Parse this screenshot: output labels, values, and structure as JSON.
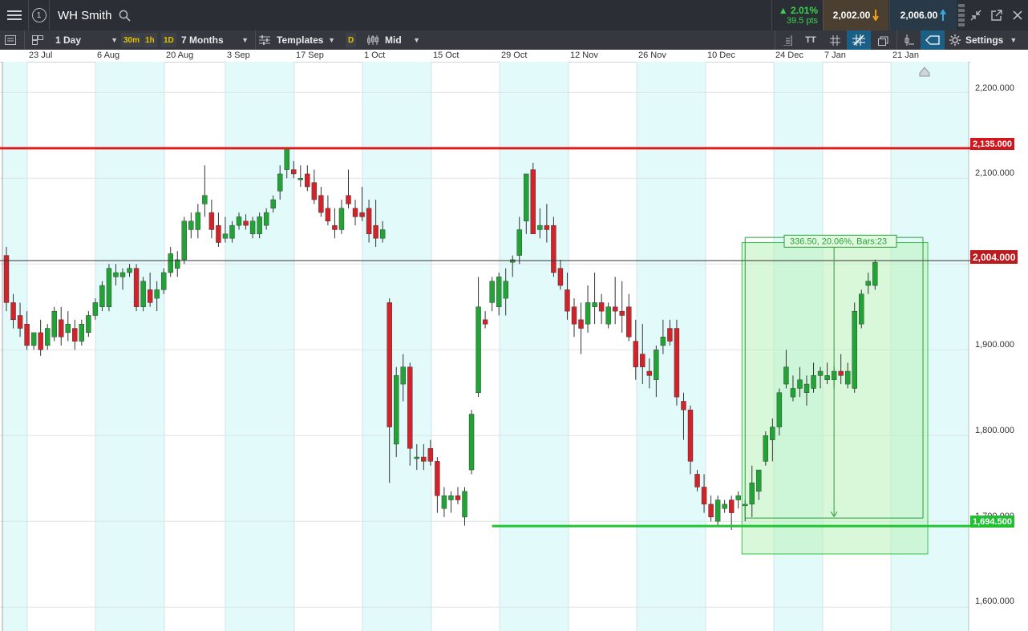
{
  "header": {
    "title": "WH Smith",
    "change_pct": "▲ 2.01%",
    "change_pts": "39.5 pts",
    "sell_price": "2,002.00",
    "buy_price": "2,006.00",
    "info_icon": "1"
  },
  "toolbar": {
    "interval": "1 Day",
    "quick_intervals": [
      "30m",
      "1h",
      "1D"
    ],
    "range": "7 Months",
    "templates": "Templates",
    "d_label": "D",
    "price_type": "Mid",
    "tt_label": "TT",
    "settings": "Settings"
  },
  "date_axis": [
    "23 Jul",
    "6 Aug",
    "20 Aug",
    "3 Sep",
    "17 Sep",
    "1 Oct",
    "15 Oct",
    "29 Oct",
    "12 Nov",
    "26 Nov",
    "10 Dec",
    "24 Dec",
    "7 Jan",
    "21 Jan"
  ],
  "price_axis": [
    "2,200.000",
    "2,100.000",
    "1,900.000",
    "1,800.000",
    "1,600.000"
  ],
  "price_badges": {
    "resistance": "2,135.000",
    "current": "2,004.000",
    "support": "1,694.500",
    "obscured_tick": "1,700.000"
  },
  "measure_label": "336.50, 20.06%, Bars:23",
  "colors": {
    "up": "#21a336",
    "down": "#d0232a",
    "resistance_line": "#e01b1b",
    "support_line": "#22c433",
    "band": "#e3fafa",
    "measure_box": "#baf3ba"
  },
  "chart_data": {
    "type": "candlestick",
    "instrument": "WH Smith",
    "interval": "1 Day",
    "ylim": [
      1570,
      2230
    ],
    "horizontal_lines": [
      2135,
      2004,
      1694.5
    ],
    "measurement": {
      "from": 1694.5,
      "to": 2031,
      "change": 336.5,
      "change_pct": 20.06,
      "bars": 23
    },
    "candles": [
      {
        "o": 2010,
        "h": 2020,
        "l": 1945,
        "c": 1955
      },
      {
        "o": 1955,
        "h": 1965,
        "l": 1925,
        "c": 1935
      },
      {
        "o": 1940,
        "h": 1955,
        "l": 1915,
        "c": 1925
      },
      {
        "o": 1930,
        "h": 1945,
        "l": 1900,
        "c": 1905
      },
      {
        "o": 1905,
        "h": 1920,
        "l": 1900,
        "c": 1920
      },
      {
        "o": 1920,
        "h": 1935,
        "l": 1893,
        "c": 1900
      },
      {
        "o": 1905,
        "h": 1930,
        "l": 1900,
        "c": 1925
      },
      {
        "o": 1915,
        "h": 1950,
        "l": 1910,
        "c": 1945
      },
      {
        "o": 1935,
        "h": 1950,
        "l": 1905,
        "c": 1915
      },
      {
        "o": 1920,
        "h": 1945,
        "l": 1910,
        "c": 1930
      },
      {
        "o": 1925,
        "h": 1935,
        "l": 1900,
        "c": 1910
      },
      {
        "o": 1910,
        "h": 1935,
        "l": 1905,
        "c": 1930
      },
      {
        "o": 1920,
        "h": 1945,
        "l": 1915,
        "c": 1940
      },
      {
        "o": 1940,
        "h": 1960,
        "l": 1935,
        "c": 1955
      },
      {
        "o": 1950,
        "h": 1980,
        "l": 1945,
        "c": 1975
      },
      {
        "o": 1950,
        "h": 2000,
        "l": 1945,
        "c": 1995
      },
      {
        "o": 1985,
        "h": 2000,
        "l": 1975,
        "c": 1990
      },
      {
        "o": 1985,
        "h": 1995,
        "l": 1970,
        "c": 1990
      },
      {
        "o": 1990,
        "h": 2000,
        "l": 1985,
        "c": 1995
      },
      {
        "o": 1995,
        "h": 2000,
        "l": 1945,
        "c": 1950
      },
      {
        "o": 1950,
        "h": 1985,
        "l": 1945,
        "c": 1980
      },
      {
        "o": 1970,
        "h": 1990,
        "l": 1950,
        "c": 1955
      },
      {
        "o": 1960,
        "h": 1980,
        "l": 1945,
        "c": 1970
      },
      {
        "o": 1970,
        "h": 1995,
        "l": 1965,
        "c": 1990
      },
      {
        "o": 1990,
        "h": 2020,
        "l": 1985,
        "c": 2012
      },
      {
        "o": 1995,
        "h": 2015,
        "l": 1985,
        "c": 2005
      },
      {
        "o": 2005,
        "h": 2055,
        "l": 2000,
        "c": 2050
      },
      {
        "o": 2040,
        "h": 2060,
        "l": 2030,
        "c": 2050
      },
      {
        "o": 2040,
        "h": 2070,
        "l": 2030,
        "c": 2060
      },
      {
        "o": 2070,
        "h": 2115,
        "l": 2055,
        "c": 2080
      },
      {
        "o": 2060,
        "h": 2075,
        "l": 2030,
        "c": 2040
      },
      {
        "o": 2045,
        "h": 2060,
        "l": 2020,
        "c": 2025
      },
      {
        "o": 2030,
        "h": 2055,
        "l": 2025,
        "c": 2035
      },
      {
        "o": 2030,
        "h": 2050,
        "l": 2025,
        "c": 2045
      },
      {
        "o": 2045,
        "h": 2060,
        "l": 2040,
        "c": 2055
      },
      {
        "o": 2050,
        "h": 2058,
        "l": 2040,
        "c": 2045
      },
      {
        "o": 2035,
        "h": 2055,
        "l": 2030,
        "c": 2050
      },
      {
        "o": 2035,
        "h": 2060,
        "l": 2030,
        "c": 2055
      },
      {
        "o": 2045,
        "h": 2065,
        "l": 2040,
        "c": 2060
      },
      {
        "o": 2065,
        "h": 2080,
        "l": 2060,
        "c": 2075
      },
      {
        "o": 2085,
        "h": 2115,
        "l": 2075,
        "c": 2105
      },
      {
        "o": 2110,
        "h": 2135,
        "l": 2100,
        "c": 2135
      },
      {
        "o": 2110,
        "h": 2120,
        "l": 2100,
        "c": 2105
      },
      {
        "o": 2100,
        "h": 2115,
        "l": 2090,
        "c": 2100
      },
      {
        "o": 2105,
        "h": 2115,
        "l": 2085,
        "c": 2090
      },
      {
        "o": 2095,
        "h": 2110,
        "l": 2070,
        "c": 2075
      },
      {
        "o": 2080,
        "h": 2090,
        "l": 2055,
        "c": 2060
      },
      {
        "o": 2065,
        "h": 2080,
        "l": 2045,
        "c": 2050
      },
      {
        "o": 2045,
        "h": 2065,
        "l": 2030,
        "c": 2040
      },
      {
        "o": 2040,
        "h": 2075,
        "l": 2035,
        "c": 2065
      },
      {
        "o": 2080,
        "h": 2110,
        "l": 2065,
        "c": 2070
      },
      {
        "o": 2065,
        "h": 2075,
        "l": 2045,
        "c": 2055
      },
      {
        "o": 2060,
        "h": 2090,
        "l": 2050,
        "c": 2055
      },
      {
        "o": 2065,
        "h": 2075,
        "l": 2025,
        "c": 2035
      },
      {
        "o": 2045,
        "h": 2075,
        "l": 2020,
        "c": 2030
      },
      {
        "o": 2030,
        "h": 2050,
        "l": 2025,
        "c": 2040
      },
      {
        "o": 1955,
        "h": 1960,
        "l": 1745,
        "c": 1810
      },
      {
        "o": 1790,
        "h": 1880,
        "l": 1775,
        "c": 1870
      },
      {
        "o": 1860,
        "h": 1895,
        "l": 1840,
        "c": 1880
      },
      {
        "o": 1880,
        "h": 1885,
        "l": 1765,
        "c": 1785
      },
      {
        "o": 1775,
        "h": 1790,
        "l": 1760,
        "c": 1775
      },
      {
        "o": 1775,
        "h": 1790,
        "l": 1760,
        "c": 1770
      },
      {
        "o": 1785,
        "h": 1795,
        "l": 1765,
        "c": 1770
      },
      {
        "o": 1770,
        "h": 1775,
        "l": 1710,
        "c": 1730
      },
      {
        "o": 1715,
        "h": 1740,
        "l": 1705,
        "c": 1730
      },
      {
        "o": 1725,
        "h": 1735,
        "l": 1710,
        "c": 1730
      },
      {
        "o": 1730,
        "h": 1740,
        "l": 1720,
        "c": 1725
      },
      {
        "o": 1705,
        "h": 1740,
        "l": 1695,
        "c": 1735
      },
      {
        "o": 1760,
        "h": 1830,
        "l": 1755,
        "c": 1825
      },
      {
        "o": 1850,
        "h": 1985,
        "l": 1845,
        "c": 1950
      },
      {
        "o": 1935,
        "h": 1945,
        "l": 1925,
        "c": 1930
      },
      {
        "o": 1955,
        "h": 1985,
        "l": 1945,
        "c": 1980
      },
      {
        "o": 1950,
        "h": 1990,
        "l": 1940,
        "c": 1985
      },
      {
        "o": 1960,
        "h": 1995,
        "l": 1940,
        "c": 1980
      },
      {
        "o": 2002,
        "h": 2010,
        "l": 1985,
        "c": 2005
      },
      {
        "o": 2010,
        "h": 2055,
        "l": 2000,
        "c": 2040
      },
      {
        "o": 2050,
        "h": 2080,
        "l": 2035,
        "c": 2105
      },
      {
        "o": 2110,
        "h": 2118,
        "l": 2040,
        "c": 2035
      },
      {
        "o": 2040,
        "h": 2065,
        "l": 2030,
        "c": 2045
      },
      {
        "o": 2045,
        "h": 2070,
        "l": 2025,
        "c": 2040
      },
      {
        "o": 2045,
        "h": 2055,
        "l": 1985,
        "c": 1990
      },
      {
        "o": 1995,
        "h": 2005,
        "l": 1970,
        "c": 1975
      },
      {
        "o": 1970,
        "h": 1990,
        "l": 1935,
        "c": 1945
      },
      {
        "o": 1950,
        "h": 1960,
        "l": 1915,
        "c": 1930
      },
      {
        "o": 1935,
        "h": 1955,
        "l": 1895,
        "c": 1925
      },
      {
        "o": 1930,
        "h": 1975,
        "l": 1920,
        "c": 1955
      },
      {
        "o": 1950,
        "h": 1990,
        "l": 1930,
        "c": 1955
      },
      {
        "o": 1955,
        "h": 1965,
        "l": 1930,
        "c": 1945
      },
      {
        "o": 1930,
        "h": 1955,
        "l": 1925,
        "c": 1950
      },
      {
        "o": 1950,
        "h": 1985,
        "l": 1930,
        "c": 1945
      },
      {
        "o": 1945,
        "h": 1980,
        "l": 1920,
        "c": 1940
      },
      {
        "o": 1950,
        "h": 1965,
        "l": 1910,
        "c": 1915
      },
      {
        "o": 1910,
        "h": 1935,
        "l": 1865,
        "c": 1880
      },
      {
        "o": 1895,
        "h": 1930,
        "l": 1860,
        "c": 1880
      },
      {
        "o": 1875,
        "h": 1890,
        "l": 1855,
        "c": 1870
      },
      {
        "o": 1865,
        "h": 1905,
        "l": 1845,
        "c": 1900
      },
      {
        "o": 1905,
        "h": 1935,
        "l": 1895,
        "c": 1915
      },
      {
        "o": 1925,
        "h": 1935,
        "l": 1905,
        "c": 1910
      },
      {
        "o": 1925,
        "h": 1935,
        "l": 1835,
        "c": 1845
      },
      {
        "o": 1840,
        "h": 1850,
        "l": 1795,
        "c": 1830
      },
      {
        "o": 1830,
        "h": 1835,
        "l": 1755,
        "c": 1770
      },
      {
        "o": 1755,
        "h": 1760,
        "l": 1735,
        "c": 1740
      },
      {
        "o": 1740,
        "h": 1755,
        "l": 1710,
        "c": 1720
      },
      {
        "o": 1720,
        "h": 1730,
        "l": 1700,
        "c": 1705
      },
      {
        "o": 1700,
        "h": 1730,
        "l": 1695,
        "c": 1725
      },
      {
        "o": 1715,
        "h": 1725,
        "l": 1710,
        "c": 1720
      },
      {
        "o": 1725,
        "h": 1730,
        "l": 1690,
        "c": 1710
      },
      {
        "o": 1725,
        "h": 1735,
        "l": 1715,
        "c": 1730
      },
      {
        "o": 1720,
        "h": 1725,
        "l": 1700,
        "c": 1720
      },
      {
        "o": 1720,
        "h": 1765,
        "l": 1705,
        "c": 1745
      },
      {
        "o": 1735,
        "h": 1760,
        "l": 1725,
        "c": 1760
      },
      {
        "o": 1770,
        "h": 1805,
        "l": 1765,
        "c": 1800
      },
      {
        "o": 1795,
        "h": 1820,
        "l": 1770,
        "c": 1810
      },
      {
        "o": 1810,
        "h": 1855,
        "l": 1800,
        "c": 1850
      },
      {
        "o": 1860,
        "h": 1900,
        "l": 1855,
        "c": 1880
      },
      {
        "o": 1845,
        "h": 1870,
        "l": 1840,
        "c": 1855
      },
      {
        "o": 1855,
        "h": 1880,
        "l": 1845,
        "c": 1865
      },
      {
        "o": 1850,
        "h": 1870,
        "l": 1835,
        "c": 1860
      },
      {
        "o": 1855,
        "h": 1885,
        "l": 1850,
        "c": 1870
      },
      {
        "o": 1870,
        "h": 1880,
        "l": 1855,
        "c": 1875
      },
      {
        "o": 1865,
        "h": 1885,
        "l": 1860,
        "c": 1870
      },
      {
        "o": 1865,
        "h": 1880,
        "l": 1855,
        "c": 1875
      },
      {
        "o": 1875,
        "h": 1895,
        "l": 1860,
        "c": 1870
      },
      {
        "o": 1860,
        "h": 1885,
        "l": 1855,
        "c": 1875
      },
      {
        "o": 1855,
        "h": 1955,
        "l": 1850,
        "c": 1945
      },
      {
        "o": 1930,
        "h": 1970,
        "l": 1925,
        "c": 1965
      },
      {
        "o": 1975,
        "h": 1990,
        "l": 1965,
        "c": 1980
      },
      {
        "o": 1975,
        "h": 2005,
        "l": 1970,
        "c": 2002
      }
    ]
  }
}
